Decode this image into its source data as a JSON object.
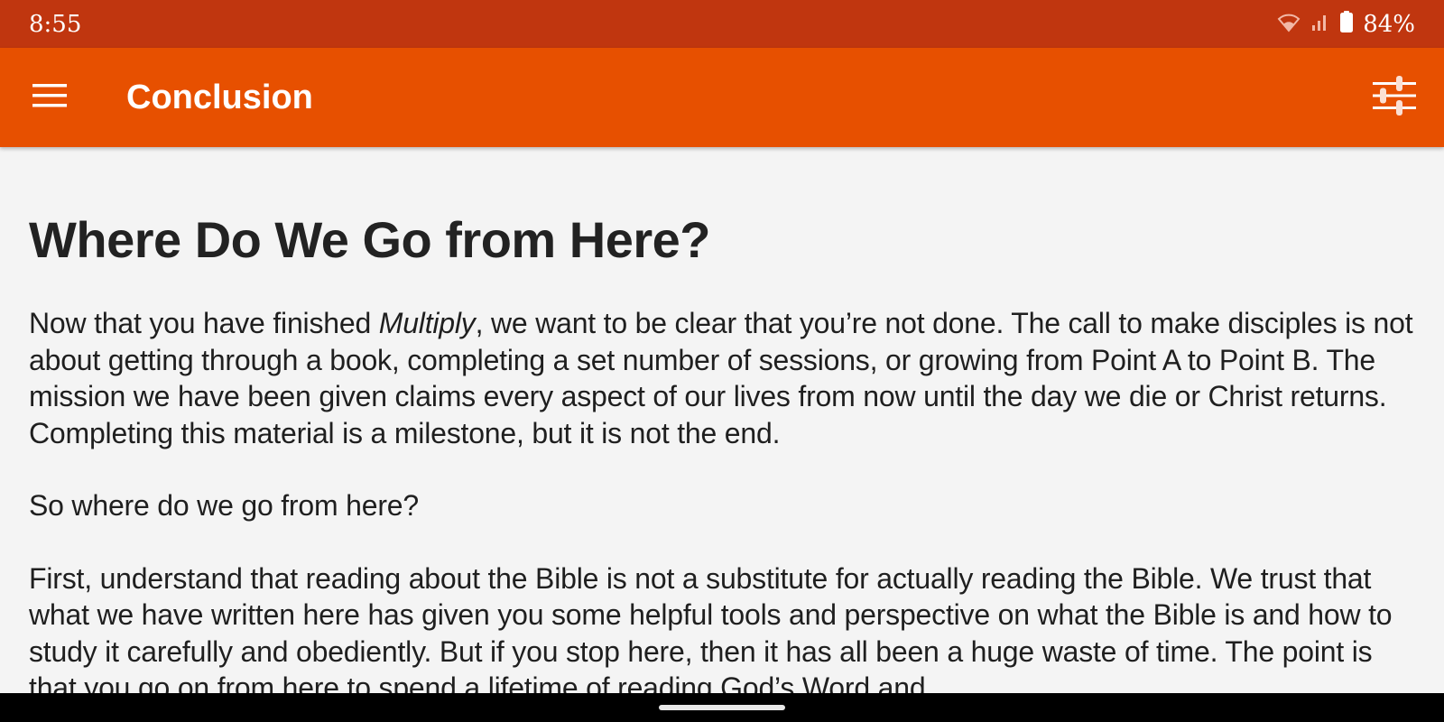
{
  "status_bar": {
    "time": "8:55",
    "battery": "84%",
    "icons": [
      "wifi-icon",
      "signal-icon",
      "battery-icon"
    ]
  },
  "app_bar": {
    "title": "Conclusion",
    "menu_icon": "hamburger-menu-icon",
    "settings_icon": "sliders-settings-icon",
    "color": "#e75000"
  },
  "article": {
    "heading": "Where Do We Go from Here?",
    "p1_before": "Now that you have finished ",
    "p1_italic": "Multiply",
    "p1_after": ", we want to be clear that you’re not done. The call to make disciples is not about getting through a book, completing a set number of sessions, or growing from Point A to Point B. The mission we have been given claims every aspect of our lives from now until the day we die or Christ returns. Completing this material is a milestone, but it is not the end.",
    "p2": "So where do we go from here?",
    "p3": "First, understand that reading about the Bible is not a substitute for actually reading the Bible. We trust that what we have written here has given you some helpful tools and perspective on what the Bible is and how to study it carefully and obediently. But if you stop here, then it has all been a huge waste of time. The point is that you go on from here to spend a lifetime of reading God’s Word and"
  },
  "colors": {
    "status_bar": "#c0360f",
    "app_bar": "#e75000",
    "background": "#f4f4f4"
  }
}
